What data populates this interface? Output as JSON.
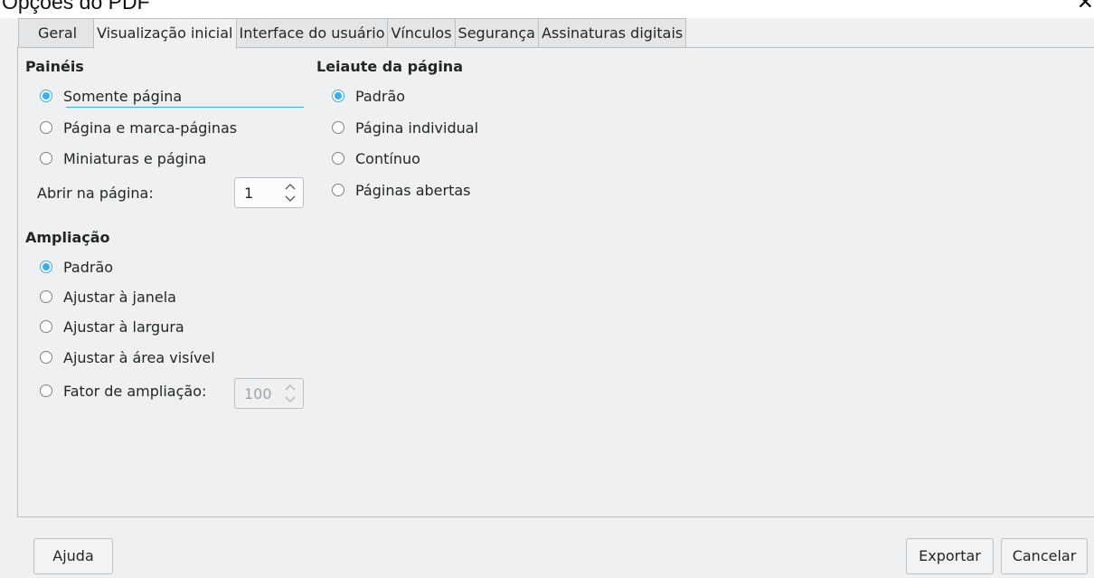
{
  "window": {
    "title": "Opções do PDF",
    "close_glyph": "✕"
  },
  "tabs": [
    {
      "label": "Geral"
    },
    {
      "label": "Visualização inicial"
    },
    {
      "label": "Interface do usuário"
    },
    {
      "label": "Vínculos"
    },
    {
      "label": "Segurança"
    },
    {
      "label": "Assinaturas digitais"
    }
  ],
  "active_tab": "Visualização inicial",
  "paineis": {
    "heading": "Painéis",
    "options": [
      {
        "label": "Somente página",
        "selected": true
      },
      {
        "label": "Página e marca-páginas",
        "selected": false
      },
      {
        "label": "Miniaturas e página",
        "selected": false
      }
    ],
    "open_page_label": "Abrir na página:",
    "open_page_value": "1"
  },
  "ampliacao": {
    "heading": "Ampliação",
    "options": [
      {
        "label": "Padrão",
        "selected": true
      },
      {
        "label": "Ajustar à janela",
        "selected": false
      },
      {
        "label": "Ajustar à largura",
        "selected": false
      },
      {
        "label": "Ajustar à área visível",
        "selected": false
      },
      {
        "label": "Fator de ampliação:",
        "selected": false
      }
    ],
    "zoom_value": "100"
  },
  "leiaute": {
    "heading": "Leiaute da página",
    "options": [
      {
        "label": "Padrão",
        "selected": true
      },
      {
        "label": "Página individual",
        "selected": false
      },
      {
        "label": "Contínuo",
        "selected": false
      },
      {
        "label": "Páginas abertas",
        "selected": false
      }
    ]
  },
  "buttons": {
    "help": "Ajuda",
    "export": "Exportar",
    "cancel": "Cancelar"
  },
  "colors": {
    "accent": "#3daee9",
    "window_bg": "#eff0f1",
    "border": "#bcc0c3"
  }
}
